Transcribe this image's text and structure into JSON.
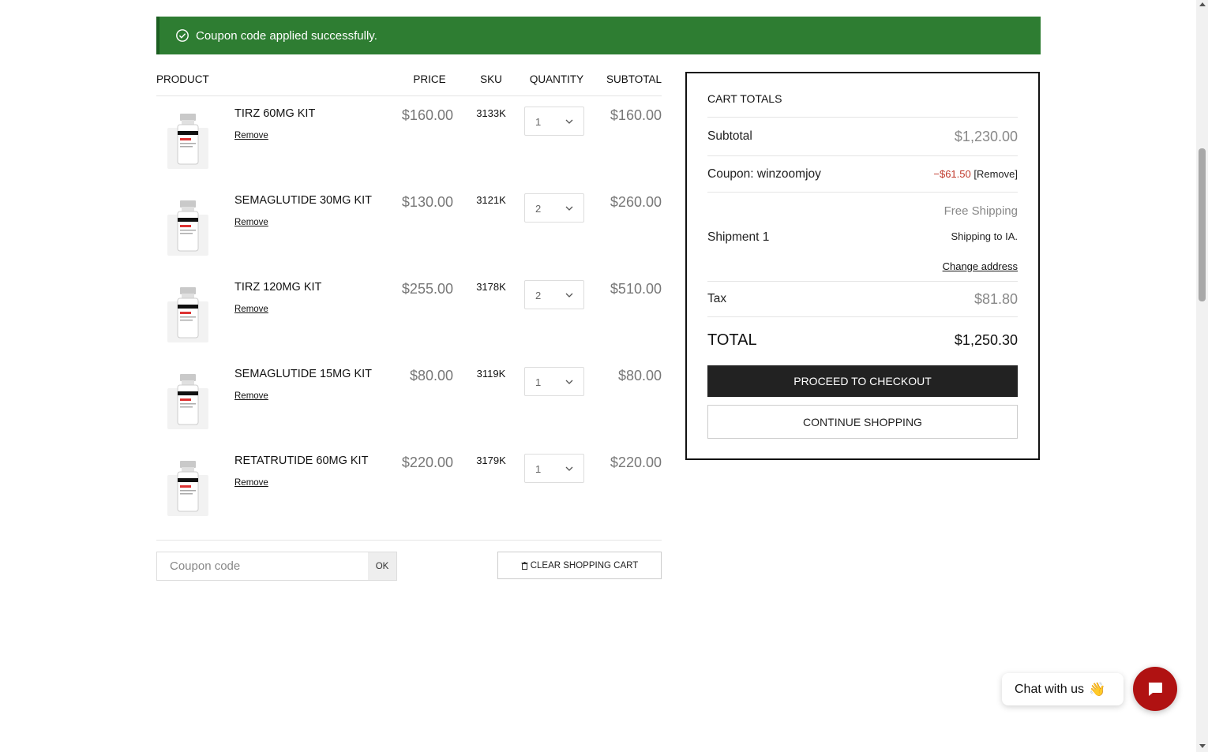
{
  "notice": {
    "message": "Coupon code applied successfully.",
    "color": "#2e7d32"
  },
  "table": {
    "headers": {
      "product": "PRODUCT",
      "price": "PRICE",
      "sku": "SKU",
      "quantity": "QUANTITY",
      "subtotal": "SUBTOTAL"
    },
    "remove_label": "Remove",
    "rows": [
      {
        "name": "TIRZ 60MG KIT",
        "price": "$160.00",
        "sku": "3133K",
        "qty": "1",
        "subtotal": "$160.00"
      },
      {
        "name": "SEMAGLUTIDE 30MG KIT",
        "price": "$130.00",
        "sku": "3121K",
        "qty": "2",
        "subtotal": "$260.00"
      },
      {
        "name": "TIRZ 120MG KIT",
        "price": "$255.00",
        "sku": "3178K",
        "qty": "2",
        "subtotal": "$510.00"
      },
      {
        "name": "SEMAGLUTIDE 15MG KIT",
        "price": "$80.00",
        "sku": "3119K",
        "qty": "1",
        "subtotal": "$80.00"
      },
      {
        "name": "RETATRUTIDE 60MG KIT",
        "price": "$220.00",
        "sku": "3179K",
        "qty": "1",
        "subtotal": "$220.00"
      }
    ]
  },
  "coupon": {
    "placeholder": "Coupon code",
    "ok_label": "OK"
  },
  "clear_cart_label": "CLEAR SHOPPING CART",
  "totals": {
    "title": "CART TOTALS",
    "subtotal_label": "Subtotal",
    "subtotal_value": "$1,230.00",
    "coupon_label": "Coupon: winzoomjoy",
    "coupon_value": "−$61.50",
    "coupon_remove": "[Remove]",
    "shipping_free": "Free Shipping",
    "shipment_label": "Shipment 1",
    "shipping_to": "Shipping to IA.",
    "change_address": "Change address",
    "tax_label": "Tax",
    "tax_value": "$81.80",
    "total_label": "TOTAL",
    "total_value": "$1,250.30",
    "checkout_label": "PROCEED TO CHECKOUT",
    "continue_label": "CONTINUE SHOPPING"
  },
  "chat": {
    "label": "Chat with us",
    "wave": "👋",
    "button_color": "#b01212"
  }
}
